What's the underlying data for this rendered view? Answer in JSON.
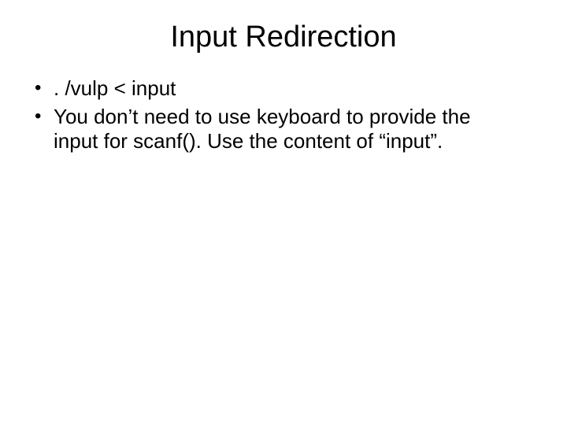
{
  "title": "Input Redirection",
  "bullets": [
    ". /vulp < input",
    "You don’t need to use keyboard to provide the input for scanf(). Use the content of “input”."
  ]
}
